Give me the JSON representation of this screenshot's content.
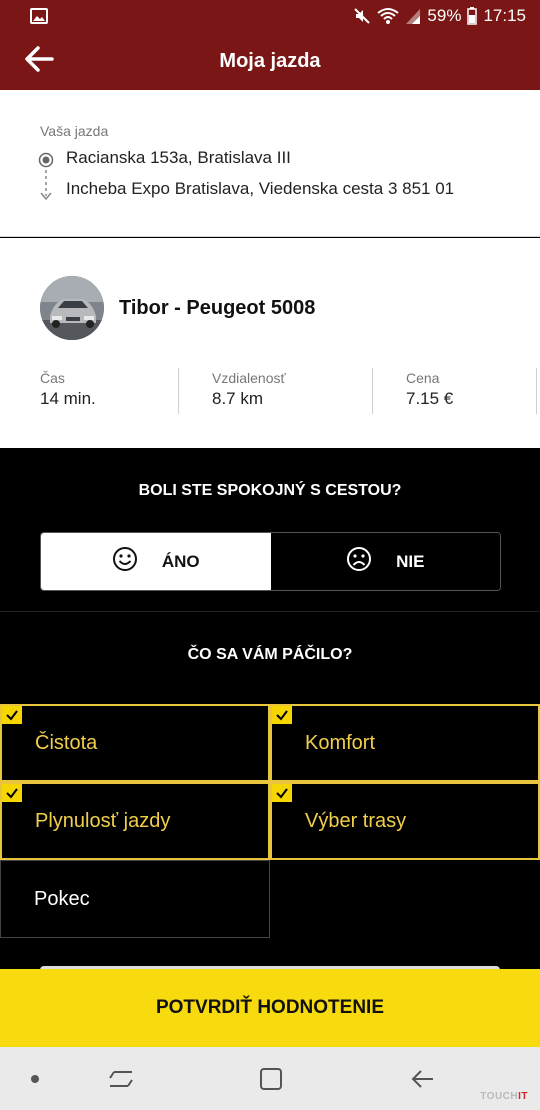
{
  "status_bar": {
    "battery": "59%",
    "time": "17:15"
  },
  "header": {
    "title": "Moja jazda"
  },
  "ride": {
    "label": "Vaša jazda",
    "from": "Racianska 153a, Bratislava III",
    "to": "Incheba Expo Bratislava, Viedenska cesta 3 851 01"
  },
  "driver": {
    "name": "Tibor - Peugeot 5008",
    "stats": [
      {
        "label": "Čas",
        "value": "14 min."
      },
      {
        "label": "Vzdialenosť",
        "value": "8.7 km"
      },
      {
        "label": "Cena",
        "value": "7.15 €"
      }
    ]
  },
  "satisfaction": {
    "question": "BOLI STE SPOKOJNÝ S CESTOU?",
    "yes_label": "ÁNO",
    "no_label": "NIE",
    "selected": "yes"
  },
  "liked": {
    "question": "ČO SA VÁM PÁČILO?",
    "options": [
      {
        "label": "Čistota",
        "selected": true
      },
      {
        "label": "Komfort",
        "selected": true
      },
      {
        "label": "Plynulosť jazdy",
        "selected": true
      },
      {
        "label": "Výber trasy",
        "selected": true
      },
      {
        "label": "Pokec",
        "selected": false
      }
    ]
  },
  "confirm_label": "POTVRDIŤ HODNOTENIE",
  "watermark": {
    "part1": "TOUCH",
    "part2": "IT"
  },
  "colors": {
    "header": "#7a1616",
    "accent": "#f7db0e",
    "selected_border": "#e8c53d"
  },
  "icons": [
    "image-icon",
    "mute-icon",
    "wifi-icon",
    "signal-icon",
    "battery-icon",
    "back-arrow-icon",
    "origin-icon",
    "dashed-arrow-icon",
    "smile-icon",
    "frown-icon",
    "check-icon",
    "nav-dot-icon",
    "recent-apps-icon",
    "home-icon",
    "back-icon"
  ]
}
